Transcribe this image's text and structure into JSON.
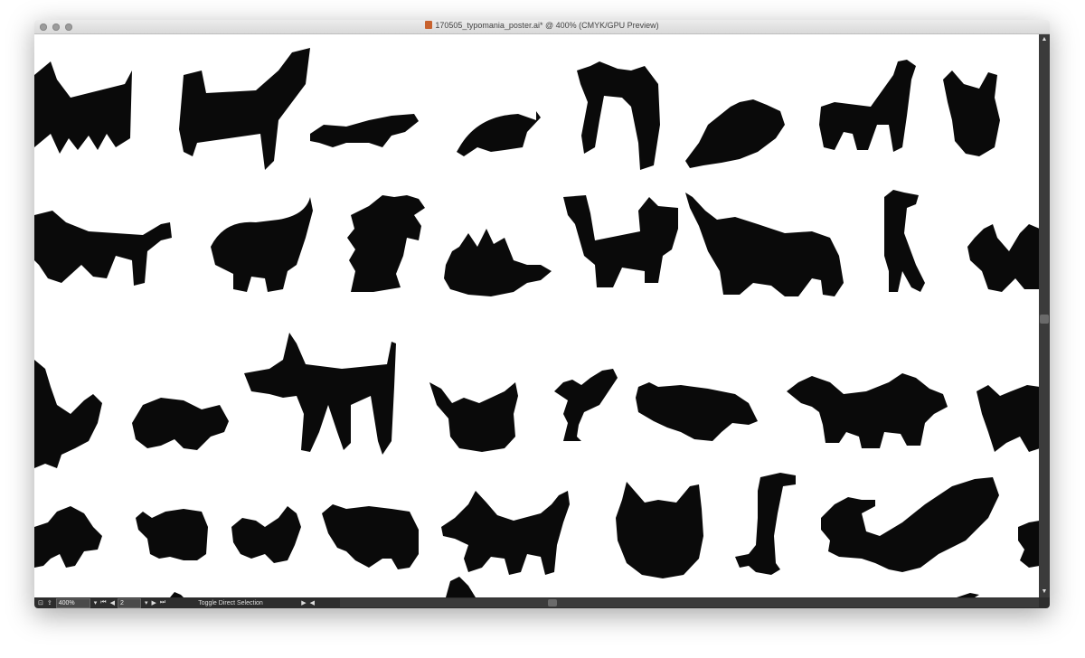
{
  "window": {
    "title": "170505_typomania_poster.ai* @ 400% (CMYK/GPU Preview)"
  },
  "statusbar": {
    "zoom": "400%",
    "page": "2",
    "tool_status": "Toggle Direct Selection"
  },
  "colors": {
    "shape_fill": "#0a0a0a",
    "statusbar_bg": "#2d2d2d",
    "titlebar_bg": "#e3e3e3"
  },
  "icons": [
    "close-dot-icon",
    "minimize-dot-icon",
    "zoom-dot-icon",
    "ai-file-icon",
    "chevron-down-icon",
    "first-page-icon",
    "prev-page-icon",
    "next-page-icon",
    "last-page-icon",
    "arrow-right-icon",
    "scroll-left-icon",
    "scroll-right-icon",
    "scroll-up-icon",
    "scroll-down-icon"
  ]
}
